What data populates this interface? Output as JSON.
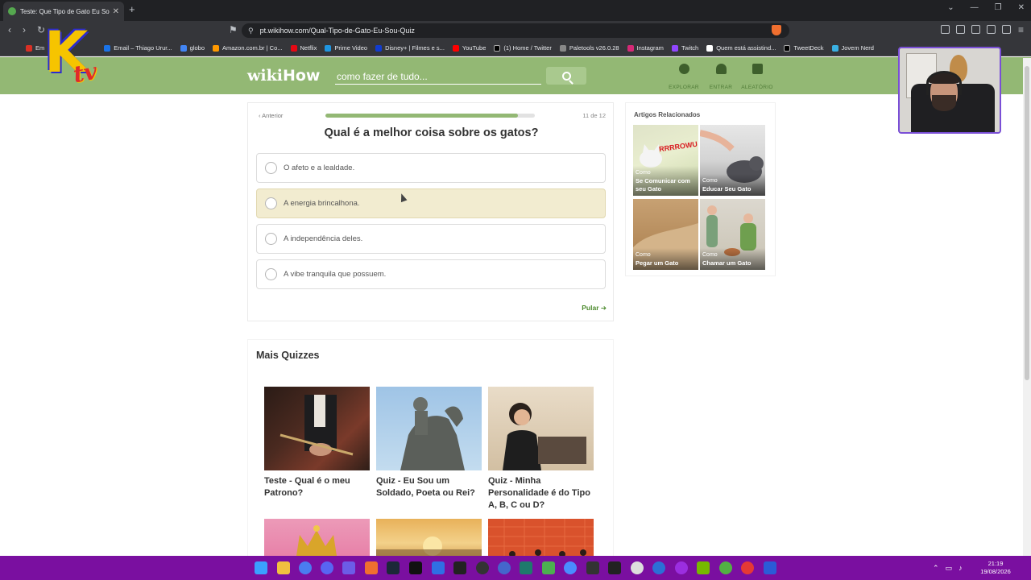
{
  "browser": {
    "tab_title": "Teste: Que Tipo de Gato Eu Sou?",
    "url": "pt.wikihow.com/Qual-Tipo-de-Gato-Eu-Sou-Quiz",
    "bookmarks": [
      "Em",
      "Email – Thiago Urur...",
      "globo",
      "Amazon.com.br | Co...",
      "Netflix",
      "Prime Video",
      "Disney+ | Filmes e s...",
      "YouTube",
      "(1) Home / Twitter",
      "Paletools v26.0.28",
      "Instagram",
      "Twitch",
      "Quem está assistind...",
      "TweetDeck",
      "Jovem Nerd"
    ]
  },
  "overlay": {
    "logo_k": "K",
    "logo_tv": "tv"
  },
  "header": {
    "logo_wiki": "wiki",
    "logo_how": "How",
    "search_placeholder": "como fazer de tudo...",
    "nav": [
      {
        "label": "EXPLORAR",
        "icon": "compass-icon"
      },
      {
        "label": "ENTRAR",
        "icon": "user-icon"
      },
      {
        "label": "ALEATÓRIO",
        "icon": "dice-icon"
      }
    ]
  },
  "quiz": {
    "prev_label": "‹ Anterior",
    "progress": 0.92,
    "counter": "11 de 12",
    "question": "Qual é a melhor coisa sobre os gatos?",
    "options": [
      "O afeto e a lealdade.",
      "A energia brincalhona.",
      "A independência deles.",
      "A vibe tranquila que possuem."
    ],
    "hovered_option": 1,
    "skip_label": "Pular ➔"
  },
  "related": {
    "title": "Artigos Relacionados",
    "items": [
      {
        "como": "Como",
        "title": "Se Comunicar com seu Gato",
        "badge": "RRRROWU"
      },
      {
        "como": "Como",
        "title": "Educar Seu Gato"
      },
      {
        "como": "Como",
        "title": "Pegar um Gato"
      },
      {
        "como": "Como",
        "title": "Chamar um Gato"
      }
    ]
  },
  "more": {
    "title": "Mais Quizzes",
    "items": [
      "Teste - Qual é o meu Patrono?",
      "Quiz - Eu Sou um Soldado, Poeta ou Rei?",
      "Quiz - Minha Personalidade é do Tipo A, B, C ou D?"
    ]
  },
  "taskbar": {
    "time": "21:19",
    "date": "19/08/2026"
  },
  "colors": {
    "wikihow_green": "#93b874",
    "accent_green": "#4b8a2c",
    "taskbar_purple": "#7a0fa0"
  }
}
